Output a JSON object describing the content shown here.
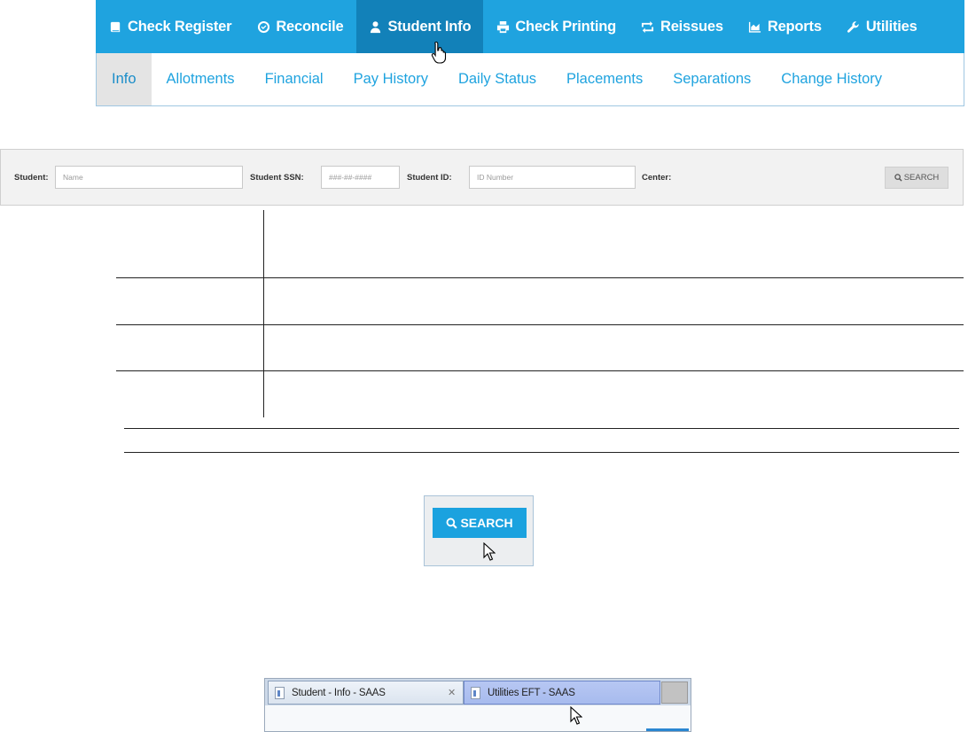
{
  "main_nav": [
    {
      "label": "Check Register",
      "icon": "book-icon",
      "active": false
    },
    {
      "label": "Reconcile",
      "icon": "check-circle-icon",
      "active": false
    },
    {
      "label": "Student Info",
      "icon": "user-icon",
      "active": true
    },
    {
      "label": "Check Printing",
      "icon": "printer-icon",
      "active": false
    },
    {
      "label": "Reissues",
      "icon": "retweet-icon",
      "active": false
    },
    {
      "label": "Reports",
      "icon": "area-chart-icon",
      "active": false
    },
    {
      "label": "Utilities",
      "icon": "wrench-icon",
      "active": false
    }
  ],
  "sub_nav": [
    {
      "label": "Info",
      "active": true
    },
    {
      "label": "Allotments",
      "active": false
    },
    {
      "label": "Financial",
      "active": false
    },
    {
      "label": "Pay History",
      "active": false
    },
    {
      "label": "Daily Status",
      "active": false
    },
    {
      "label": "Placements",
      "active": false
    },
    {
      "label": "Separations",
      "active": false
    },
    {
      "label": "Change History",
      "active": false
    }
  ],
  "search_bar": {
    "student_label": "Student:",
    "student_placeholder": "Name",
    "ssn_label": "Student SSN:",
    "ssn_placeholder": "###-##-####",
    "id_label": "Student ID:",
    "id_placeholder": "ID Number",
    "center_label": "Center:",
    "search_label": "SEARCH"
  },
  "callout": {
    "search_label": "SEARCH"
  },
  "browser_tabs": [
    {
      "label": "Student - Info - SAAS",
      "active": false,
      "closable": true
    },
    {
      "label": "Utilities EFT - SAAS",
      "active": true,
      "closable": false
    }
  ],
  "colors": {
    "nav_blue": "#1fa3df",
    "nav_active": "#1281b9",
    "sub_active_bg": "#e4e4e4"
  }
}
